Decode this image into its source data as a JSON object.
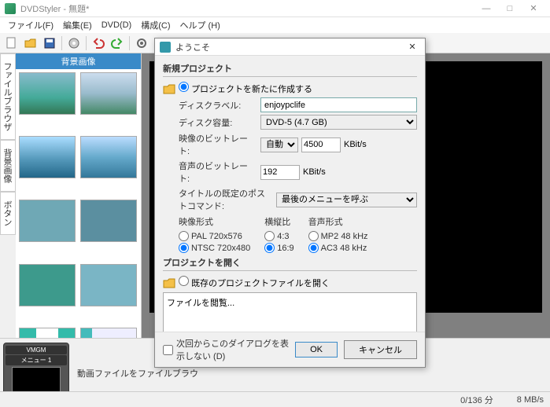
{
  "window": {
    "title": "DVDStyler - 無題*"
  },
  "menu": {
    "file": "ファイル(F)",
    "edit": "編集(E)",
    "dvd": "DVD(D)",
    "config": "構成(C)",
    "help": "ヘルプ (H)"
  },
  "sidetabs": {
    "browser": "ファイルブラウザ",
    "bg": "背景画像",
    "btn": "ボタン"
  },
  "thumb_header": "背景画像",
  "bottom": {
    "vmgm": "VMGM",
    "menu1": "メニュー 1",
    "hint": "動画ファイルをファイルブラウ"
  },
  "status": {
    "duration": "0/136 分",
    "bitrate": "8 MB/s"
  },
  "dialog": {
    "title": "ようこそ",
    "section_new": "新規プロジェクト",
    "radio_new": "プロジェクトを新たに作成する",
    "label_disc": "ディスクラベル:",
    "value_disc": "enjoypclife",
    "label_capacity": "ディスク容量:",
    "value_capacity": "DVD-5 (4.7 GB)",
    "label_vbitrate": "映像のビットレート:",
    "vbitrate_mode": "自動",
    "vbitrate_val": "4500",
    "unit_kbits": "KBit/s",
    "label_abitrate": "音声のビットレート:",
    "abitrate_val": "192",
    "label_postcmd": "タイトルの既定のポストコマンド:",
    "postcmd_val": "最後のメニューを呼ぶ",
    "col_video": "映像形式",
    "video_pal": "PAL 720x576",
    "video_ntsc": "NTSC 720x480",
    "col_aspect": "横縦比",
    "aspect_43": "4:3",
    "aspect_169": "16:9",
    "col_audio": "音声形式",
    "audio_mp2": "MP2 48 kHz",
    "audio_ac3": "AC3 48 kHz",
    "section_open": "プロジェクトを開く",
    "radio_open": "既存のプロジェクトファイルを開く",
    "browse": "ファイルを閲覧...",
    "checkbox": "次回からこのダイアログを表示しない (D)",
    "ok": "OK",
    "cancel": "キャンセル"
  }
}
